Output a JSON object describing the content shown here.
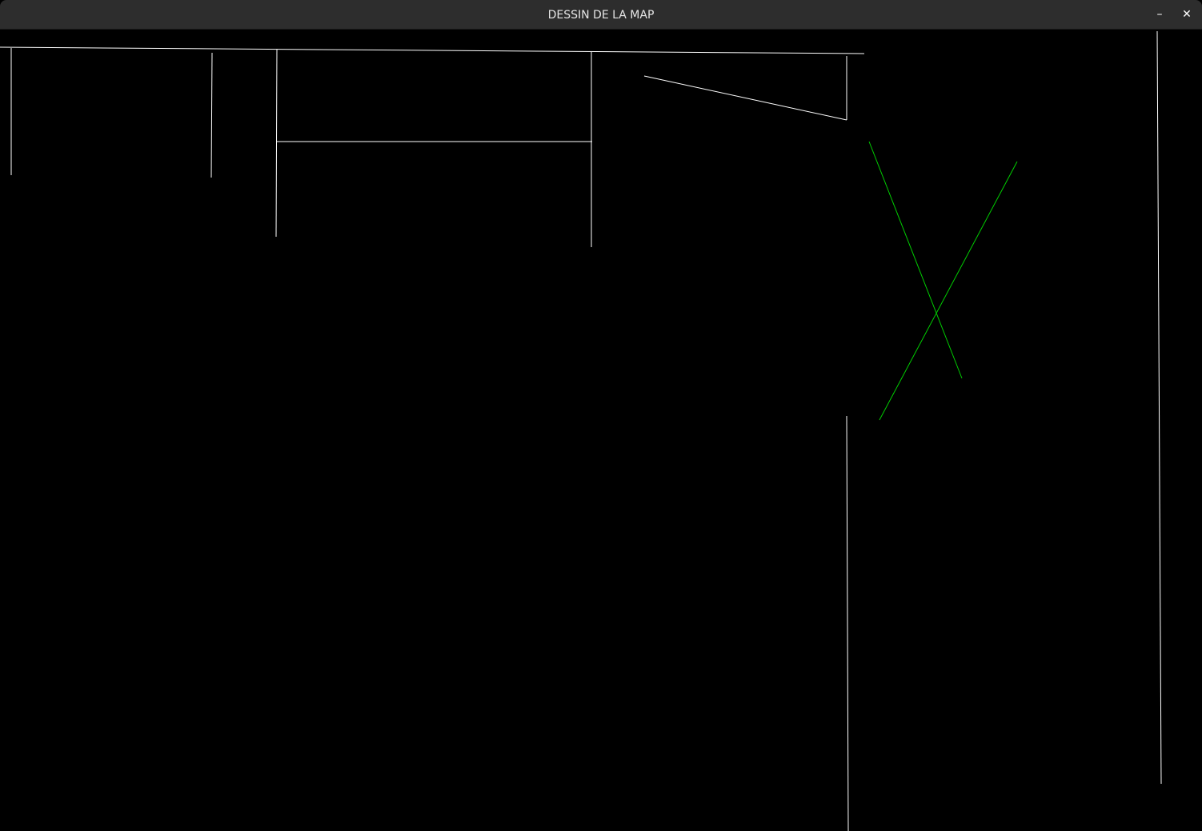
{
  "window": {
    "title": "DESSIN DE LA MAP"
  },
  "controls": {
    "minimize_glyph": "–",
    "close_glyph": "✕"
  },
  "map": {
    "background_color": "#000000",
    "wall_color": "#ffffff",
    "ray_color": "#00cc00"
  }
}
